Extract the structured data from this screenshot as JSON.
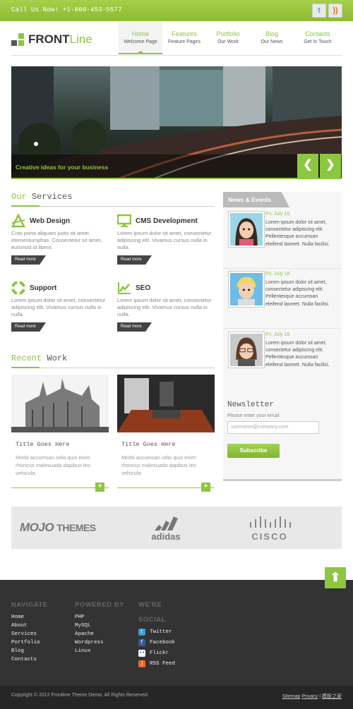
{
  "topbar": {
    "phone": "Call Us Now! +1-800-453-5577",
    "twitter_glyph": "t",
    "rss_glyph": "))"
  },
  "logo": {
    "front": "FRONT",
    "line": "Line"
  },
  "nav": [
    {
      "label": "Home",
      "sub": "Welcome Page"
    },
    {
      "label": "Features",
      "sub": "Feature Pages"
    },
    {
      "label": "Portfolio",
      "sub": "Our Work"
    },
    {
      "label": "Blog",
      "sub": "Our News"
    },
    {
      "label": "Contacts",
      "sub": "Get In Touch"
    }
  ],
  "hero": {
    "caption": "Creative ideas for your business",
    "prev": "❮",
    "next": "❯"
  },
  "services": {
    "title_a": "Our",
    "title_b": "Services",
    "items": [
      {
        "name": "Web Design",
        "text": "Cras porta aliquam justo sit amet elementumphas. Consectetur sit amet, euismod id libero.",
        "btn": "Read more"
      },
      {
        "name": "CMS Development",
        "text": "Lorem ipsum dolor sit amet, consectetur adipiscing elit. Vivamus cursus nulla in nulla.",
        "btn": "Read more"
      },
      {
        "name": "Support",
        "text": "Lorem ipsum dolor sit amet, consectetur adipiscing elit. Vivamus cursus nulla in nulla.",
        "btn": "Read more"
      },
      {
        "name": "SEO",
        "text": "Lorem ipsum dolor sit amet, consectetur adipiscing elit. Vivamus cursus nulla in nulla.",
        "btn": "Read more"
      }
    ]
  },
  "recent": {
    "title_a": "Recent",
    "title_b": "Work",
    "items": [
      {
        "title": "Title Goes Here",
        "text": "Morbi accumsan odio quis enim rhoncus malesuada dapibus leo vehicula.",
        "plus": "+"
      },
      {
        "title": "Title Goes Here",
        "text": "Morbi accumsan odio quis enim rhoncus malesuada dapibus leo vehicula.",
        "plus": "+"
      }
    ]
  },
  "news": {
    "tab": "News & Events",
    "items": [
      {
        "date": "Fri, July 18",
        "text": "Lorem ipsum dolor sit amet, consectetur adipiscing elit. Pellentesque accumsan eleifend laoreet. Nulla facilisi."
      },
      {
        "date": "Fri, July 18",
        "text": "Lorem ipsum dolor sit amet, consectetur adipiscing elit. Pellentesque accumsan eleifend laoreet. Nulla facilisi."
      },
      {
        "date": "Fri, July 18",
        "text": "Lorem ipsum dolor sit amet, consectetur adipiscing elit. Pellentesque accumsan eleifend laoreet. Nulla facilisi."
      }
    ]
  },
  "newsletter": {
    "title": "Newsletter",
    "label": "Please enter your email",
    "placeholder": "username@company.com",
    "button": "Subscribe"
  },
  "partners": {
    "mojo": "MOJO",
    "themes": "THEMES",
    "adidas": "adidas",
    "cisco": "CISCO"
  },
  "back_to_top": "⬆",
  "footer": {
    "navigate": {
      "title": "NAVIGATE",
      "links": [
        "Home",
        "About",
        "Services",
        "Portfolio",
        "Blog",
        "Contacts"
      ]
    },
    "powered": {
      "title": "POWERED BY",
      "links": [
        "PHP",
        "MySQL",
        "Apache",
        "Wordpress",
        "Linux"
      ]
    },
    "social": {
      "title_a": "WE'RE",
      "title_b": "SOCIAL",
      "links": [
        {
          "label": "Twitter",
          "glyph": "t",
          "color": "#3b9ad9"
        },
        {
          "label": "Facebook",
          "glyph": "f",
          "color": "#3b5998"
        },
        {
          "label": "Flickr",
          "glyph": "••",
          "color": "#ffffff"
        },
        {
          "label": "RSS Feed",
          "glyph": ")",
          "color": "#f26522"
        }
      ]
    },
    "copyright": "Copyright © 2012 Frontline Theme Demo. All Rights Reserved.",
    "sitemap": "Sitemap",
    "privacy": "Privacy",
    "extra": "模板之家"
  },
  "colors": {
    "accent": "#8dc63f",
    "dark": "#333333"
  }
}
